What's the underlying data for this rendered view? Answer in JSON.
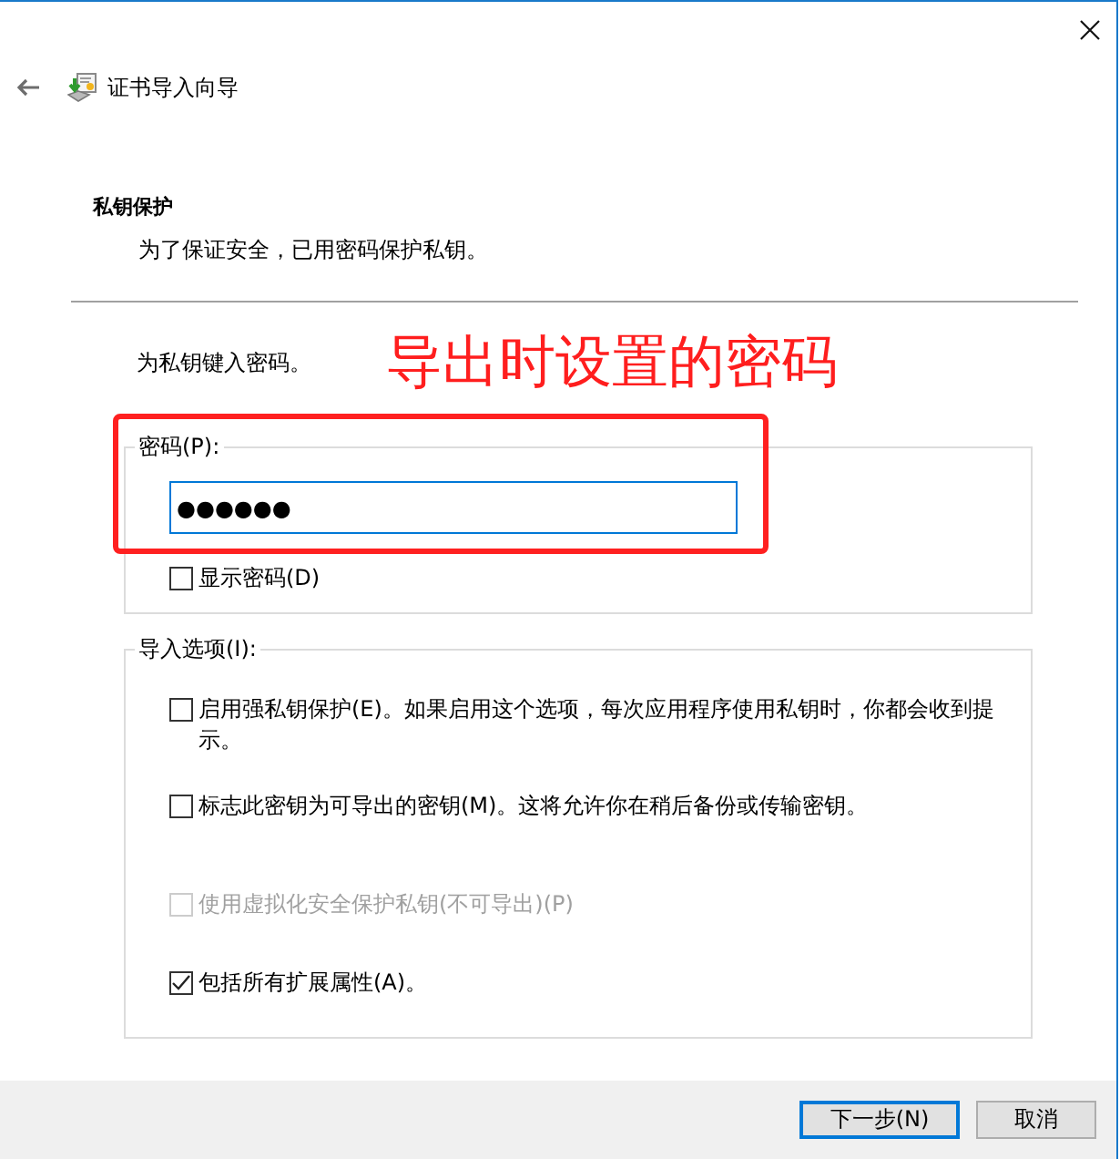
{
  "window": {
    "title": "证书导入向导"
  },
  "page": {
    "heading": "私钥保护",
    "description": "为了保证安全，已用密码保护私钥。"
  },
  "prompt": "为私钥键入密码。",
  "annotation": {
    "text": "导出时设置的密码"
  },
  "password_group": {
    "label": "密码(P):",
    "value": "●●●●●●",
    "focused": true,
    "highlighted": true
  },
  "show_password": {
    "label": "显示密码(D)",
    "checked": false
  },
  "import_options": {
    "label": "导入选项(I):",
    "options": [
      {
        "label": "启用强私钥保护(E)。如果启用这个选项，每次应用程序使用私钥时，你都会收到提示。",
        "checked": false,
        "disabled": false
      },
      {
        "label": "标志此密钥为可导出的密钥(M)。这将允许你在稍后备份或传输密钥。",
        "checked": false,
        "disabled": false
      },
      {
        "label": "使用虚拟化安全保护私钥(不可导出)(P)",
        "checked": false,
        "disabled": true
      },
      {
        "label": "包括所有扩展属性(A)。",
        "checked": true,
        "disabled": false
      }
    ]
  },
  "buttons": [
    {
      "label": "下一步(N)",
      "default": true
    },
    {
      "label": "取消",
      "default": false
    }
  ]
}
